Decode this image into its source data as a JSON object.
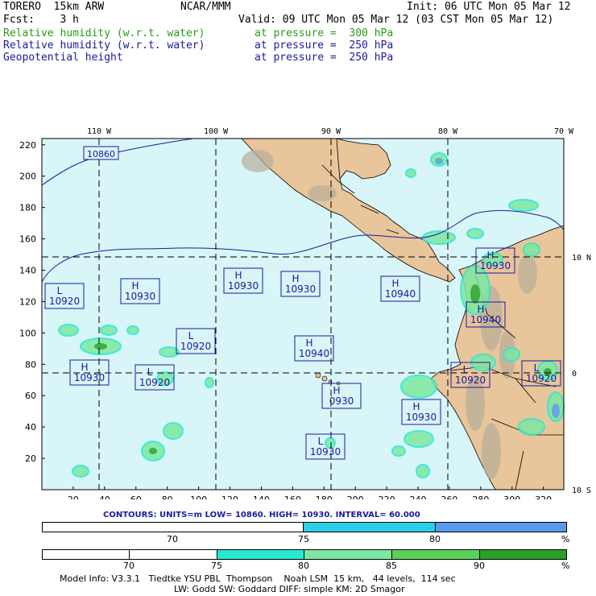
{
  "header": {
    "model": "TORERO  15km ARW",
    "org": "NCAR/MMM",
    "init": "Init: 06 UTC Mon 05 Mar 12",
    "fcst": "Fcst:    3 h",
    "valid": "Valid: 09 UTC Mon 05 Mar 12 (03 CST Mon 05 Mar 12)"
  },
  "fields": [
    {
      "name": "Relative humidity (w.r.t. water)",
      "level": "at pressure =  300 hPa",
      "color": "#2a9a1a"
    },
    {
      "name": "Relative humidity (w.r.t. water)",
      "level": "at pressure =  250 hPa",
      "color": "#1a1aa0"
    },
    {
      "name": "Geopotential height",
      "level": "at pressure =  250 hPa",
      "color": "#1a1aa0"
    }
  ],
  "map": {
    "lon_labels": [
      "110 W",
      "100 W",
      "90 W",
      "80 W",
      "70 W"
    ],
    "lat_labels": [
      "10 N",
      "0",
      "10 S"
    ],
    "x_ticks": [
      "20",
      "40",
      "60",
      "80",
      "100",
      "120",
      "140",
      "160",
      "180",
      "200",
      "220",
      "240",
      "260",
      "280",
      "300",
      "320"
    ],
    "y_ticks": [
      "220",
      "200",
      "180",
      "160",
      "140",
      "120",
      "100",
      "80",
      "60",
      "40",
      "20"
    ],
    "colors": {
      "ocean": "#d8f5f7",
      "land": "#e8c59a",
      "border": "#000000",
      "contour": "#1a1aa0",
      "grid": "#000000"
    },
    "contour_labels": [
      "10860"
    ],
    "centers": [
      {
        "type": "L",
        "value": "10920"
      },
      {
        "type": "H",
        "value": "10930"
      },
      {
        "type": "H",
        "value": "10930"
      },
      {
        "type": "H",
        "value": "10930"
      },
      {
        "type": "H",
        "value": "10940"
      },
      {
        "type": "H",
        "value": "10930"
      },
      {
        "type": "L",
        "value": "10920"
      },
      {
        "type": "H",
        "value": "10940"
      },
      {
        "type": "H",
        "value": "10930"
      },
      {
        "type": "L",
        "value": "10920"
      },
      {
        "type": "H",
        "value": "0930"
      },
      {
        "type": "H",
        "value": "10940"
      },
      {
        "type": "L",
        "value": "10920"
      },
      {
        "type": "L",
        "value": "10920"
      },
      {
        "type": "H",
        "value": "10930"
      },
      {
        "type": "L",
        "value": "10930"
      }
    ]
  },
  "contours_line": "CONTOURS:  UNITS=m  LOW=  10860.     HIGH=  10930.    INTERVAL=   60.000",
  "colorbar1": {
    "segments": [
      {
        "color": "#ffffff"
      },
      {
        "color": "#2ad0e8"
      },
      {
        "color": "#5a9aec"
      }
    ],
    "labels": [
      "70",
      "75",
      "80",
      "%"
    ]
  },
  "colorbar2": {
    "segments": [
      {
        "color": "#ffffff"
      },
      {
        "color": "#ffffff"
      },
      {
        "color": "#28e8d2"
      },
      {
        "color": "#7ee8a0"
      },
      {
        "color": "#5ad25a"
      },
      {
        "color": "#2aa02a"
      }
    ],
    "labels": [
      "70",
      "75",
      "80",
      "85",
      "90",
      "%"
    ]
  },
  "model_info_1": "Model Info: V3.3.1   Tiedtke YSU PBL  Thompson    Noah LSM  15 km,   44 levels,  114 sec",
  "model_info_2": "LW: Godd SW: Goddard DIFF: simple KM: 2D Smagor"
}
